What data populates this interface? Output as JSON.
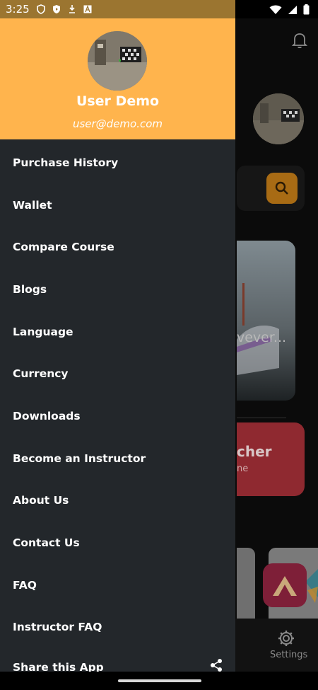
{
  "status_bar": {
    "time": "3:25",
    "notification_icons": [
      "shield-icon",
      "play-shield-icon",
      "download-arrow-icon",
      "font-a-icon"
    ],
    "system_icons": [
      "wifi-icon",
      "signal-icon",
      "battery-icon"
    ]
  },
  "drawer": {
    "user_name": "User Demo",
    "user_email": "user@demo.com",
    "menu_items": [
      {
        "label": "Purchase History"
      },
      {
        "label": "Wallet"
      },
      {
        "label": "Compare Course"
      },
      {
        "label": "Blogs"
      },
      {
        "label": "Language"
      },
      {
        "label": "Currency"
      },
      {
        "label": "Downloads"
      },
      {
        "label": "Become an Instructor"
      },
      {
        "label": "About Us"
      },
      {
        "label": "Contact Us"
      },
      {
        "label": "FAQ"
      },
      {
        "label": "Instructor FAQ"
      },
      {
        "label": "Share this App",
        "icon": "share-icon"
      }
    ],
    "header_color": "#ffb44d",
    "background_color": "#23272b"
  },
  "background_app": {
    "banner_text_fragment": "vever...",
    "card_title_fragment": "cher",
    "card_subtitle_fragment": "ne",
    "bottom_nav_settings_label": "Settings",
    "accent_color": "#a86b14",
    "card_color": "#8f2930"
  }
}
